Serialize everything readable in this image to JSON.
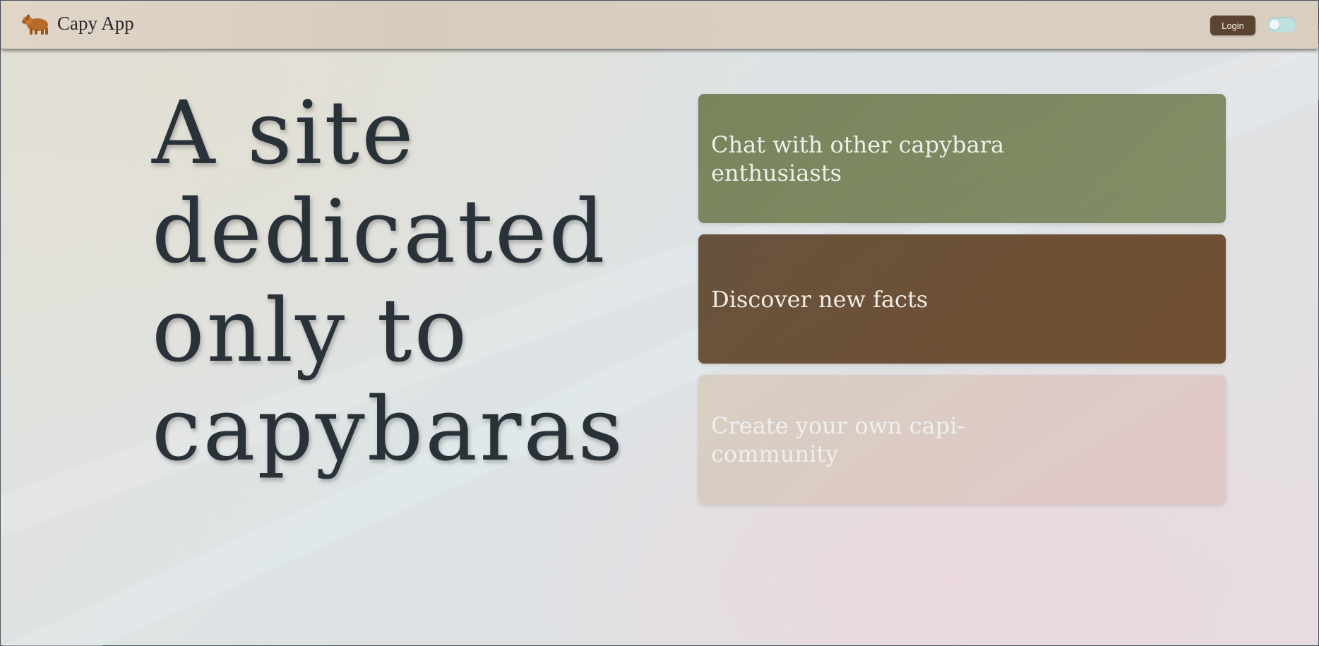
{
  "header": {
    "app_name": "Capy App",
    "logo_icon": "capybara-icon",
    "login_label": "Login",
    "theme_toggle_icon": "toggle-switch"
  },
  "hero": {
    "title": "A site dedicated only to capybaras"
  },
  "cards": [
    {
      "label": "Chat with other capybara enthusiasts",
      "color": "#767f5e"
    },
    {
      "label": "Discover new facts",
      "color": "#664a33"
    },
    {
      "label": "Create your own capi-community",
      "color": "#dbcbc2"
    }
  ],
  "colors": {
    "topbar": "#d9cec0",
    "login_button": "#5c4230",
    "hero_text": "#2a3239",
    "toggle_track": "#bfe0e0"
  }
}
